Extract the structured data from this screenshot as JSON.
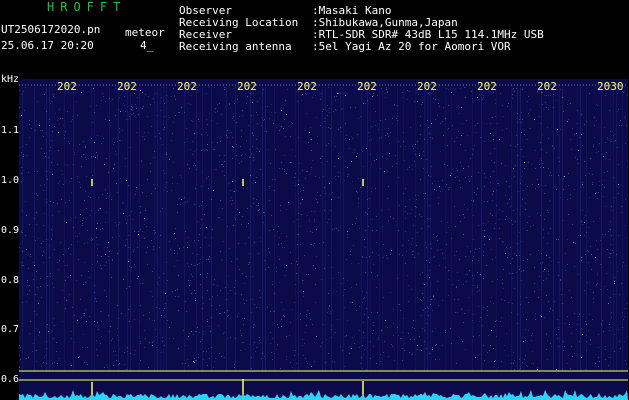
{
  "header": {
    "app_title": "HROFFT",
    "filename": "UT2506172020.pn",
    "meteor_label": "meteor",
    "datetime": "25.06.17 20:20",
    "count": "4_"
  },
  "info": [
    {
      "label": "Observer",
      "value": ":Masaki Kano"
    },
    {
      "label": "Receiving Location",
      "value": ":Shibukawa,Gunma,Japan"
    },
    {
      "label": "Receiver",
      "value": ":RTL-SDR SDR# 43dB L15 114.1MHz USB"
    },
    {
      "label": "Receiving antenna",
      "value": ":5el Yagi Az 20 for Aomori VOR"
    }
  ],
  "plot": {
    "y_unit": "kHz",
    "y_ticks": [
      "1.1",
      "1.0",
      "0.9",
      "0.8",
      "0.7",
      "0.6"
    ],
    "x_ticks": [
      "202",
      "202",
      "202",
      "202",
      "202",
      "202",
      "202",
      "202",
      "202",
      "2030"
    ],
    "colors": {
      "background": "#0b0b4a",
      "noise": "#3a50d0",
      "marker": "#ffff66",
      "spectrum": "#2ad4ff"
    }
  }
}
